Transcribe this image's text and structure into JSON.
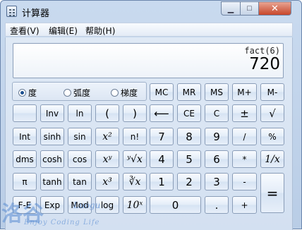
{
  "window": {
    "title": "计算器",
    "minimize_glyph": "▁",
    "maximize_glyph": "□",
    "close_glyph": "✕"
  },
  "menu": [
    "查看(V)",
    "编辑(E)",
    "帮助(H)"
  ],
  "display": {
    "expression": "fact(6)",
    "result": "720"
  },
  "angle_mode": {
    "options": [
      "度",
      "弧度",
      "梯度"
    ],
    "selected": "度"
  },
  "memory": [
    "MC",
    "MR",
    "MS",
    "M+",
    "M-"
  ],
  "rows": [
    [
      "",
      "Inv",
      "ln",
      "(",
      ")",
      "⟵",
      "CE",
      "C",
      "±",
      "√"
    ],
    [
      "Int",
      "sinh",
      "sin",
      "x²",
      "n!",
      "7",
      "8",
      "9",
      "/",
      "%"
    ],
    [
      "dms",
      "cosh",
      "cos",
      "xʸ",
      "ʸ√x",
      "4",
      "5",
      "6",
      "*",
      "1/x"
    ],
    [
      "π",
      "tanh",
      "tan",
      "x³",
      "∛x",
      "1",
      "2",
      "3",
      "-",
      "="
    ],
    [
      "F-E",
      "Exp",
      "Mod",
      "log",
      "10ˣ",
      "0",
      ".",
      "+"
    ]
  ],
  "watermark": {
    "logo": "洛谷",
    "name": "Luogu",
    "slogan": "Enjoy Coding Life"
  }
}
